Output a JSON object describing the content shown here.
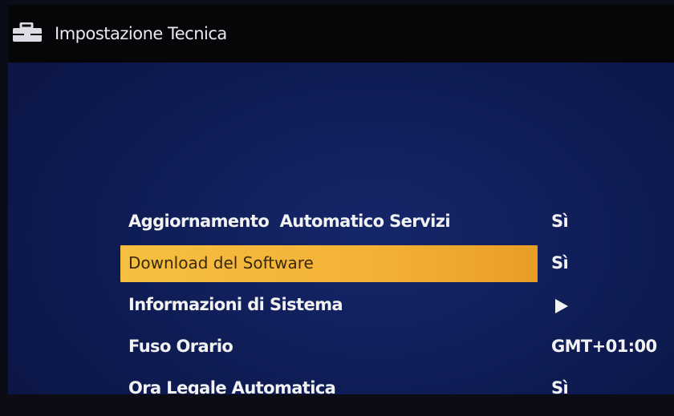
{
  "header": {
    "title": "Impostazione Tecnica",
    "icon": "toolbox-icon"
  },
  "menu": {
    "items": [
      {
        "label": "Aggiornamento  Automatico Servizi",
        "value": "Sì",
        "selected": false
      },
      {
        "label": "Download del Software",
        "value": "Sì",
        "selected": true
      },
      {
        "label": "Informazioni di Sistema",
        "value": "",
        "submenu": true,
        "selected": false
      },
      {
        "label": "Fuso Orario",
        "value": "GMT+01:00",
        "selected": false
      },
      {
        "label": "Ora Legale Automatica",
        "value": "Sì",
        "selected": false
      }
    ]
  },
  "colors": {
    "background": "#0e1b52",
    "highlight": "#f3b236",
    "topbar": "#060608",
    "text": "#f2f2f2"
  }
}
